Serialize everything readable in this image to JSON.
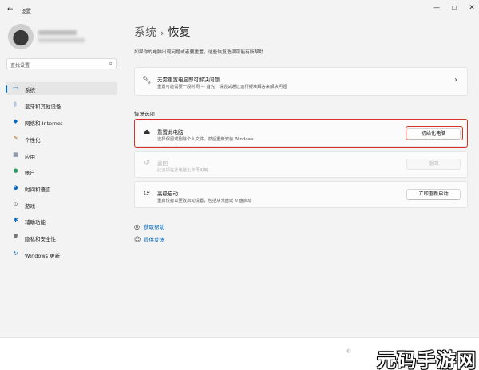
{
  "window": {
    "title": "设置"
  },
  "search": {
    "placeholder": "查找设置"
  },
  "sidebar": {
    "items": [
      {
        "label": "系统",
        "icon": "monitor-icon",
        "active": true
      },
      {
        "label": "蓝牙和其他设备",
        "icon": "bluetooth-icon"
      },
      {
        "label": "网络和 Internet",
        "icon": "wifi-icon"
      },
      {
        "label": "个性化",
        "icon": "brush-icon"
      },
      {
        "label": "应用",
        "icon": "apps-icon"
      },
      {
        "label": "帐户",
        "icon": "account-icon"
      },
      {
        "label": "时间和语言",
        "icon": "globe-clock-icon"
      },
      {
        "label": "游戏",
        "icon": "gamepad-icon"
      },
      {
        "label": "辅助功能",
        "icon": "accessibility-icon"
      },
      {
        "label": "隐私和安全性",
        "icon": "shield-icon"
      },
      {
        "label": "Windows 更新",
        "icon": "update-icon"
      }
    ]
  },
  "main": {
    "breadcrumb_parent": "系统",
    "breadcrumb_sep": "›",
    "breadcrumb_current": "恢复",
    "subtitle": "如果你的电脑出现问题或者要重置，这些恢复选项可能有所帮助",
    "fix_card": {
      "title": "无需重置电脑即可解决问题",
      "desc": "重置可能需要一段时间 — 首先，请尝试通过运行疑难解答来解决问题"
    },
    "section_label": "恢复选项",
    "reset_card": {
      "title": "重置此电脑",
      "desc": "选择保留或删除个人文件，然后重新安装 Windows",
      "button": "初始化电脑"
    },
    "goback_card": {
      "title": "返回",
      "desc": "此选项在此电脑上不再可用",
      "button": "返回"
    },
    "advanced_card": {
      "title": "高级启动",
      "desc": "重启设备以更改启动设置，包括从光盘或 U 盘启动",
      "button": "立即重新启动"
    },
    "links": {
      "help": "获取帮助",
      "feedback": "提供反馈"
    }
  },
  "watermark": {
    "brand": "元码手游网"
  },
  "colors": {
    "accent": "#0067c0",
    "highlight": "#d93025"
  }
}
